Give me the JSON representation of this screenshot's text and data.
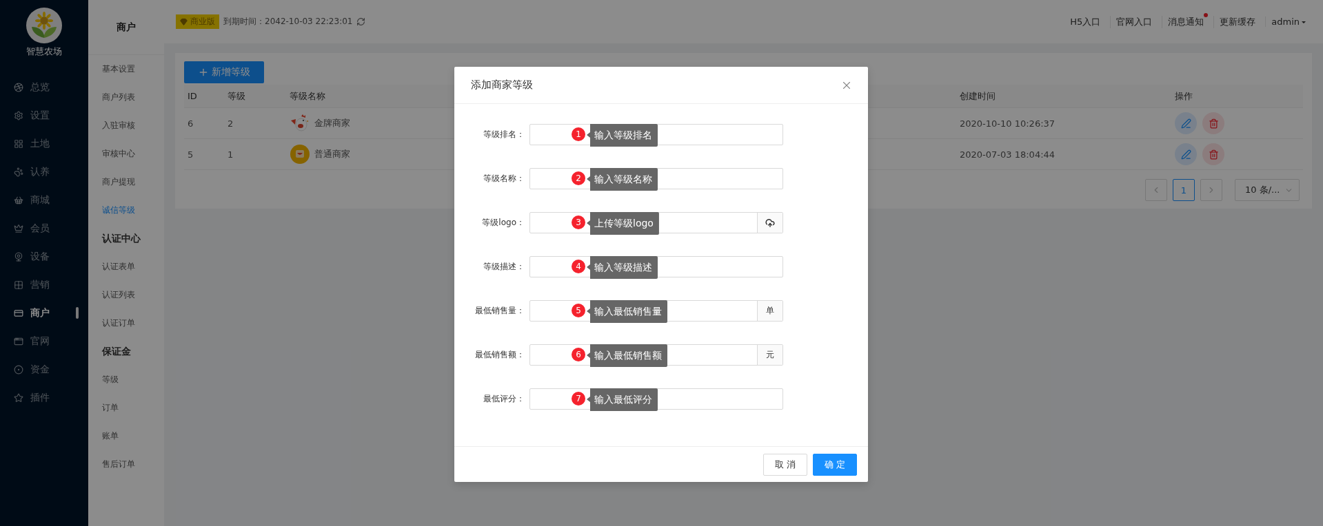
{
  "sidebar": {
    "logo_text": "智慧农场",
    "items": [
      {
        "label": "总览",
        "selected": false
      },
      {
        "label": "设置",
        "selected": false
      },
      {
        "label": "土地",
        "selected": false
      },
      {
        "label": "认养",
        "selected": false
      },
      {
        "label": "商城",
        "selected": false
      },
      {
        "label": "会员",
        "selected": false
      },
      {
        "label": "设备",
        "selected": false
      },
      {
        "label": "营销",
        "selected": false
      },
      {
        "label": "商户",
        "selected": true
      },
      {
        "label": "官网",
        "selected": false
      },
      {
        "label": "资金",
        "selected": false
      },
      {
        "label": "插件",
        "selected": false
      }
    ]
  },
  "submenu": {
    "title": "商户",
    "items": [
      {
        "kind": "link",
        "label": "基本设置",
        "selected": false
      },
      {
        "kind": "link",
        "label": "商户列表",
        "selected": false
      },
      {
        "kind": "link",
        "label": "入驻审核",
        "selected": false
      },
      {
        "kind": "link",
        "label": "审核中心",
        "selected": false
      },
      {
        "kind": "link",
        "label": "商户提现",
        "selected": false
      },
      {
        "kind": "link",
        "label": "诚信等级",
        "selected": true
      },
      {
        "kind": "group",
        "label": "认证中心"
      },
      {
        "kind": "link",
        "label": "认证表单",
        "selected": false
      },
      {
        "kind": "link",
        "label": "认证列表",
        "selected": false
      },
      {
        "kind": "link",
        "label": "认证订单",
        "selected": false
      },
      {
        "kind": "group",
        "label": "保证金"
      },
      {
        "kind": "link",
        "label": "等级",
        "selected": false
      },
      {
        "kind": "link",
        "label": "订单",
        "selected": false
      },
      {
        "kind": "link",
        "label": "账单",
        "selected": false
      },
      {
        "kind": "link",
        "label": "售后订单",
        "selected": false
      }
    ]
  },
  "header": {
    "edition": "商业版",
    "expiry": "到期时间：2042-10-03 22:23:01",
    "links": [
      {
        "label": "H5入口",
        "badge": false
      },
      {
        "label": "官网入口",
        "badge": false
      },
      {
        "label": "消息通知",
        "badge": true
      },
      {
        "label": "更新缓存",
        "badge": false
      }
    ],
    "user": "admin"
  },
  "toolbar": {
    "add_button": "新增等级"
  },
  "table": {
    "columns": [
      "ID",
      "等级",
      "等级名称",
      "创建时间",
      "操作"
    ],
    "rows": [
      {
        "id": "6",
        "level": "2",
        "name": "金牌商家",
        "created": "2020-10-10 10:26:37"
      },
      {
        "id": "5",
        "level": "1",
        "name": "普通商家",
        "created": "2020-07-03 18:04:44"
      }
    ]
  },
  "pagination": {
    "pages": [
      {
        "label": "1",
        "selected": true
      }
    ],
    "page_size": "10 条/..."
  },
  "dialog": {
    "title": "添加商家等级",
    "fields": [
      {
        "label": "等级排名：",
        "kind": "plain",
        "marker": "1",
        "hint": "输入等级排名"
      },
      {
        "label": "等级名称：",
        "kind": "plain",
        "marker": "2",
        "hint": "输入等级名称"
      },
      {
        "label": "等级logo：",
        "kind": "upload",
        "marker": "3",
        "hint": "上传等级logo"
      },
      {
        "label": "等级描述：",
        "kind": "plain",
        "marker": "4",
        "hint": "输入等级描述"
      },
      {
        "label": "最低销售量：",
        "kind": "unit",
        "suffix": "单",
        "marker": "5",
        "hint": "输入最低销售量"
      },
      {
        "label": "最低销售额：",
        "kind": "unit",
        "suffix": "元",
        "marker": "6",
        "hint": "输入最低销售额"
      },
      {
        "label": "最低评分：",
        "kind": "plain",
        "marker": "7",
        "hint": "输入最低评分"
      }
    ],
    "buttons": [
      {
        "label": "取 消",
        "kind": "default"
      },
      {
        "label": "确 定",
        "kind": "primary"
      }
    ]
  }
}
